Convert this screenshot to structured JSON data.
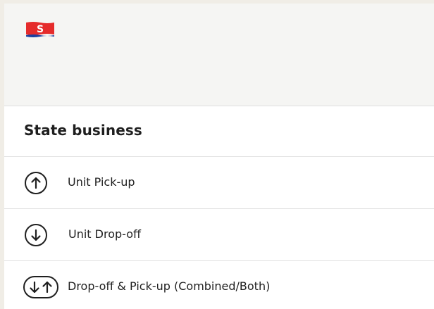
{
  "brand": {
    "logo_letter": "S",
    "logo_icon": "flag-logo-icon",
    "colors": {
      "flag_red": "#e52b2b",
      "flag_blue": "#1c3f9e",
      "text": "#1f1f1f",
      "divider": "#e1e1e1"
    }
  },
  "card": {
    "title": "State business"
  },
  "options": [
    {
      "label": "Unit Pick-up",
      "icon": "arrow-up-circle-icon"
    },
    {
      "label": "Unit Drop-off",
      "icon": "arrow-down-circle-icon"
    },
    {
      "label": "Drop-off & Pick-up (Combined/Both)",
      "icon": "arrows-down-up-pill-icon"
    }
  ]
}
